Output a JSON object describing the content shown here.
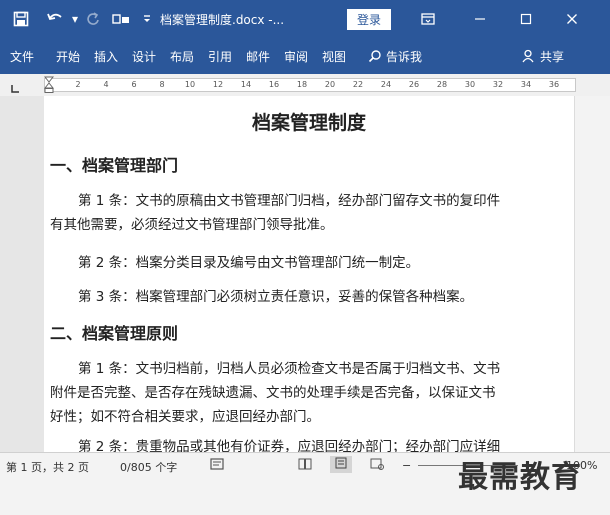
{
  "titlebar": {
    "filename": "档案管理制度.docx -...",
    "login_label": "登录"
  },
  "menu": {
    "items": [
      "文件",
      "开始",
      "插入",
      "设计",
      "布局",
      "引用",
      "邮件",
      "审阅",
      "视图"
    ],
    "tell_me": "告诉我",
    "share": "共享"
  },
  "ruler": {
    "numbers": [
      "2",
      "4",
      "6",
      "8",
      "10",
      "12",
      "14",
      "16",
      "18",
      "20",
      "22",
      "24",
      "26",
      "28",
      "30",
      "32",
      "34",
      "36"
    ]
  },
  "document": {
    "title": "档案管理制度",
    "section1_heading": "一、档案管理部门",
    "s1p1_line1": "第 1 条：文书的原稿由文书管理部门归档，经办部门留存文书的复印件",
    "s1p1_line2": "有其他需要，必须经过文书管理部门领导批准。",
    "s1p2": "第 2 条：档案分类目录及编号由文书管理部门统一制定。",
    "s1p3": "第 3 条：档案管理部门必须树立责任意识，妥善的保管各种档案。",
    "section2_heading": "二、档案管理原则",
    "s2p1_line1": "第 1 条：文书归档前，归档人员必须检查文书是否属于归档文书、文书",
    "s2p1_line2": "附件是否完整、是否存在残缺遗漏、文书的处理手续是否完备，以保证文书",
    "s2p1_line3": "好性；如不符合相关要求，应退回经办部门。",
    "s2p2": "第 2 条：贵重物品或其他有价证券，应退回经办部门；经办部门应详细"
  },
  "status": {
    "page_info": "第 1 页，共 2 页",
    "word_count": "0/805 个字",
    "zoom": "100%"
  },
  "watermark": "最需教育",
  "colors": {
    "accent": "#2b579a"
  }
}
